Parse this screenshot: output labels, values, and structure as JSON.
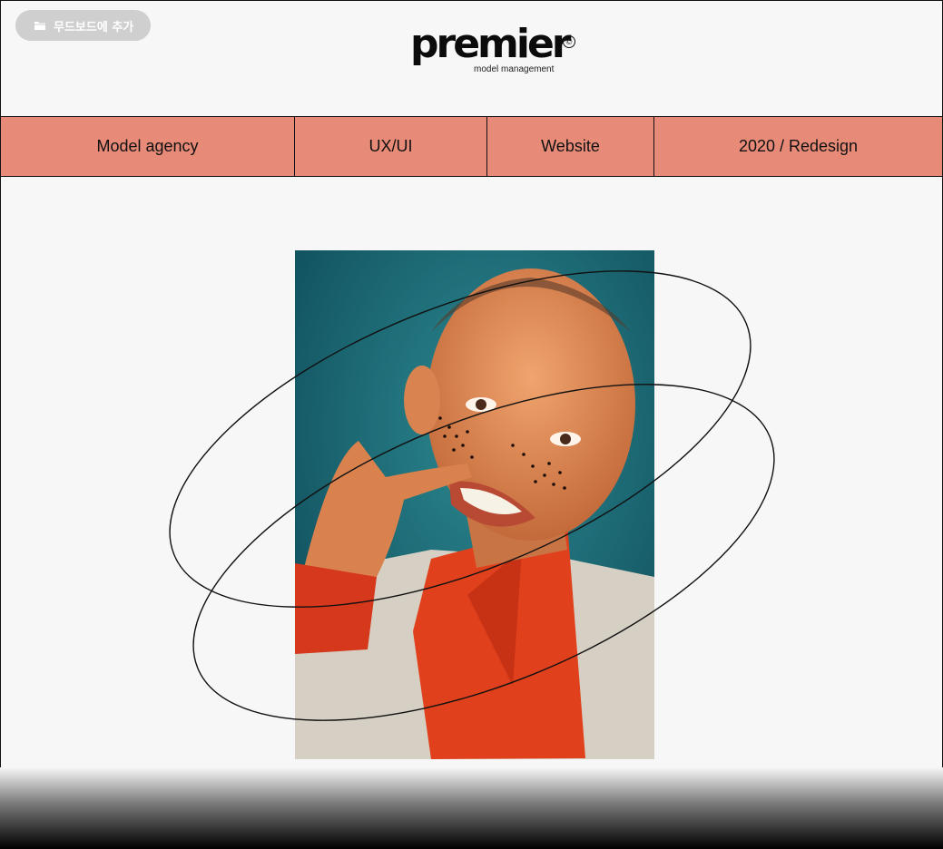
{
  "moodboard_button": {
    "label": "무드보드에 추가",
    "icon": "folder-icon"
  },
  "logo": {
    "word": "premier",
    "subtitle": "model management",
    "mark": "©"
  },
  "tags": [
    "Model agency",
    "UX/UI",
    "Website",
    "2020 / Redesign"
  ],
  "colors": {
    "tag_bar": "#e78b78",
    "background": "#f7f7f7",
    "teal_backdrop": "#1f6f7a",
    "shirt_red": "#e0401c",
    "jacket": "#d4cfc4"
  }
}
